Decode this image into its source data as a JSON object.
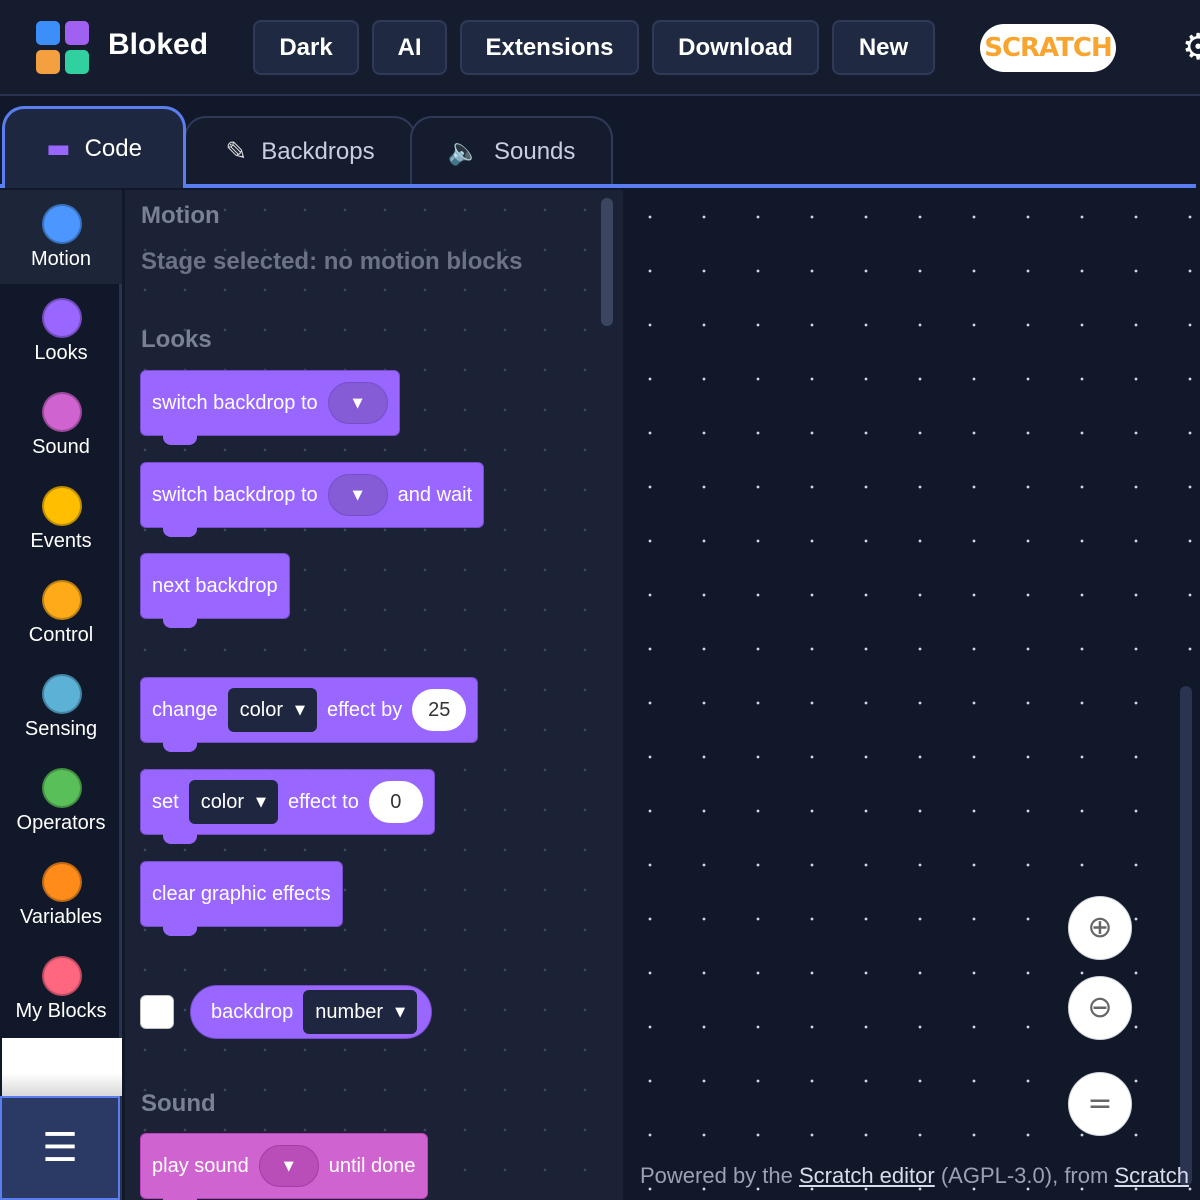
{
  "header": {
    "brand": "Bloked",
    "nav": [
      "Dark",
      "AI",
      "Extensions",
      "Download",
      "New"
    ],
    "scratch_logo_text": "SCRATCH",
    "settings_icon": "gear-icon"
  },
  "tabs": [
    {
      "label": "Code",
      "icon": "code-blocks-icon",
      "active": true
    },
    {
      "label": "Backdrops",
      "icon": "paintbrush-icon",
      "active": false
    },
    {
      "label": "Sounds",
      "icon": "speaker-icon",
      "active": false
    }
  ],
  "categories": [
    {
      "label": "Motion",
      "color": "#4c97ff",
      "selected": true
    },
    {
      "label": "Looks",
      "color": "#9966ff"
    },
    {
      "label": "Sound",
      "color": "#cf63cf"
    },
    {
      "label": "Events",
      "color": "#ffbf00"
    },
    {
      "label": "Control",
      "color": "#ffab19"
    },
    {
      "label": "Sensing",
      "color": "#5cb1d6"
    },
    {
      "label": "Operators",
      "color": "#59c059"
    },
    {
      "label": "Variables",
      "color": "#ff8c1a"
    },
    {
      "label": "My Blocks",
      "color": "#ff6680"
    }
  ],
  "flyout": {
    "motion_title": "Motion",
    "motion_note": "Stage selected: no motion blocks",
    "looks_title": "Looks",
    "sound_title": "Sound",
    "blocks": {
      "switch_backdrop": "switch backdrop to",
      "switch_backdrop_wait_pre": "switch backdrop to",
      "switch_backdrop_wait_post": "and wait",
      "next_backdrop": "next backdrop",
      "change_pre": "change",
      "change_menu": "color",
      "change_mid": "effect by",
      "change_value": "25",
      "set_pre": "set",
      "set_menu": "color",
      "set_mid": "effect to",
      "set_value": "0",
      "clear_effects": "clear graphic effects",
      "backdrop_reporter": "backdrop",
      "backdrop_menu": "number",
      "play_sound_pre": "play sound",
      "play_sound_post": "until done"
    }
  },
  "footer": {
    "prefix": "Powered by the ",
    "link1": "Scratch editor",
    "middle": " (AGPL-3.0), from ",
    "link2": "Scratch"
  }
}
